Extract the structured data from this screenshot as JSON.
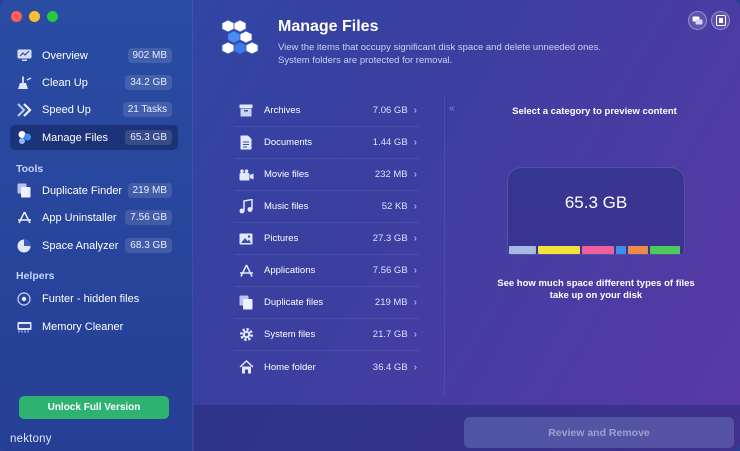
{
  "sidebar": {
    "main_items": [
      {
        "label": "Overview",
        "value": "902 MB"
      },
      {
        "label": "Clean Up",
        "value": "34.2 GB"
      },
      {
        "label": "Speed Up",
        "value": "21 Tasks"
      },
      {
        "label": "Manage Files",
        "value": "65.3 GB"
      }
    ],
    "tools_heading": "Tools",
    "tools": [
      {
        "label": "Duplicate Finder",
        "value": "219 MB"
      },
      {
        "label": "App Uninstaller",
        "value": "7.56 GB"
      },
      {
        "label": "Space Analyzer",
        "value": "68.3 GB"
      }
    ],
    "helpers_heading": "Helpers",
    "helpers": [
      {
        "label": "Funter - hidden files"
      },
      {
        "label": "Memory Cleaner"
      }
    ],
    "unlock_label": "Unlock Full Version",
    "logo": "nektony"
  },
  "header": {
    "title": "Manage Files",
    "subtitle": "View the items that occupy significant disk space and delete unneeded ones. System folders are protected for removal."
  },
  "categories": [
    {
      "label": "Archives",
      "value": "7.06 GB",
      "icon": "archive-icon"
    },
    {
      "label": "Documents",
      "value": "1.44 GB",
      "icon": "document-icon"
    },
    {
      "label": "Movie files",
      "value": "232 MB",
      "icon": "movie-icon"
    },
    {
      "label": "Music files",
      "value": "52 KB",
      "icon": "music-icon"
    },
    {
      "label": "Pictures",
      "value": "27.3 GB",
      "icon": "picture-icon"
    },
    {
      "label": "Applications",
      "value": "7.56 GB",
      "icon": "applications-icon"
    },
    {
      "label": "Duplicate files",
      "value": "219 MB",
      "icon": "duplicate-icon"
    },
    {
      "label": "System files",
      "value": "21.7 GB",
      "icon": "gear-icon"
    },
    {
      "label": "Home folder",
      "value": "36.4 GB",
      "icon": "home-icon"
    }
  ],
  "preview": {
    "hint": "Select a category to preview content",
    "total": "65.3 GB",
    "description": "See how much space different types of files take up on your disk",
    "bar_segments": [
      {
        "color": "#a9b7e6",
        "share": 0.16
      },
      {
        "color": "#f2e23a",
        "share": 0.25
      },
      {
        "color": "#ee5fa0",
        "share": 0.19
      },
      {
        "color": "#3f8ff0",
        "share": 0.06
      },
      {
        "color": "#f08a48",
        "share": 0.12
      },
      {
        "color": "#4ccb5a",
        "share": 0.18
      }
    ]
  },
  "footer": {
    "review_label": "Review and Remove"
  }
}
